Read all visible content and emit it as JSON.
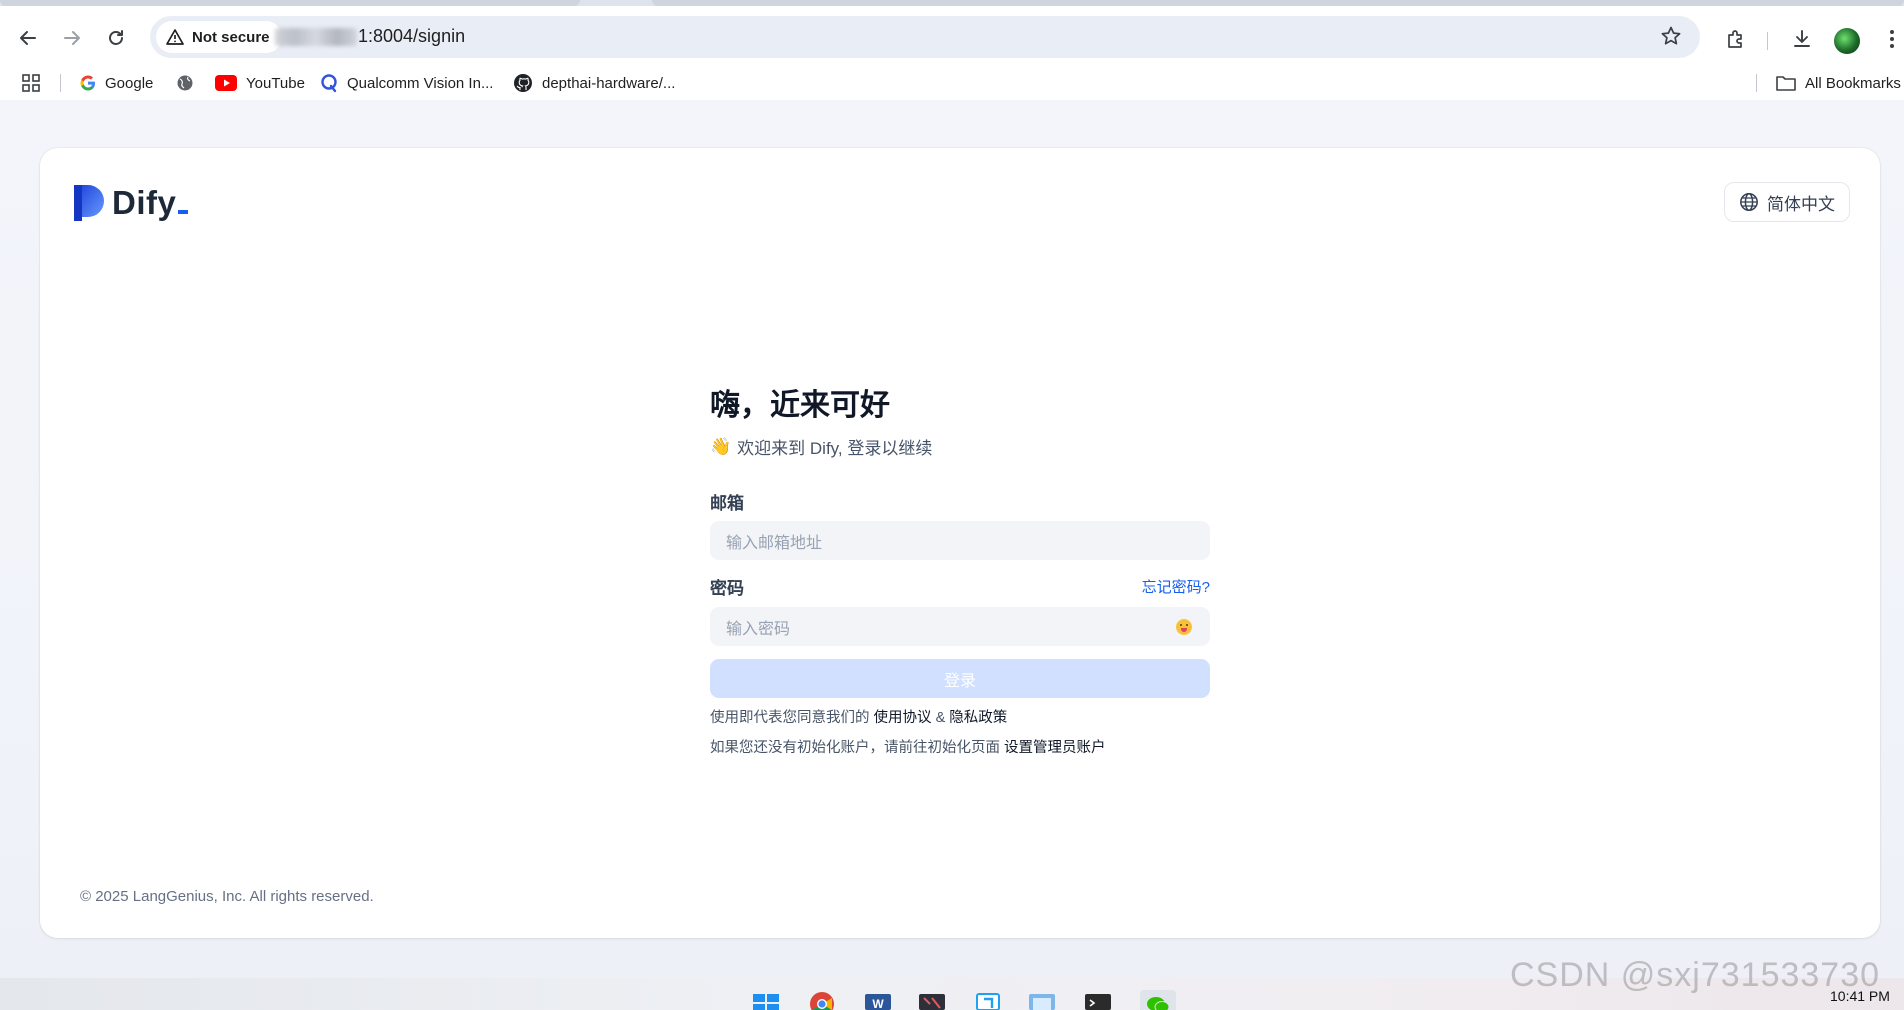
{
  "browser": {
    "security_label": "Not secure",
    "url_suffix": "1:8004/signin",
    "bookmarks": [
      {
        "label": "Google"
      },
      {
        "label": "YouTube"
      },
      {
        "label": "Qualcomm Vision In..."
      },
      {
        "label": "depthai-hardware/..."
      }
    ],
    "all_bookmarks_label": "All Bookmarks"
  },
  "page": {
    "logo_text": "Dify",
    "language_label": "简体中文",
    "title": "嗨，近来可好",
    "subtitle_emoji": "👋",
    "subtitle": "欢迎来到 Dify, 登录以继续",
    "email": {
      "label": "邮箱",
      "placeholder": "输入邮箱地址"
    },
    "password": {
      "label": "密码",
      "forgot_label": "忘记密码?",
      "placeholder": "输入密码"
    },
    "submit_label": "登录",
    "terms": {
      "prefix": "使用即代表您同意我们的",
      "terms_link": "使用协议",
      "amp": "&",
      "privacy_link": "隐私政策"
    },
    "init": {
      "prefix": "如果您还没有初始化账户，请前往初始化页面",
      "link": "设置管理员账户"
    },
    "copyright": "© 2025 LangGenius, Inc. All rights reserved."
  },
  "taskbar": {
    "clock": "10:41 PM"
  },
  "watermark": "CSDN @sxj731533730",
  "colors": {
    "accent": "#155eef",
    "button_disabled": "#d1e0ff",
    "input_bg": "#f2f4f7"
  }
}
